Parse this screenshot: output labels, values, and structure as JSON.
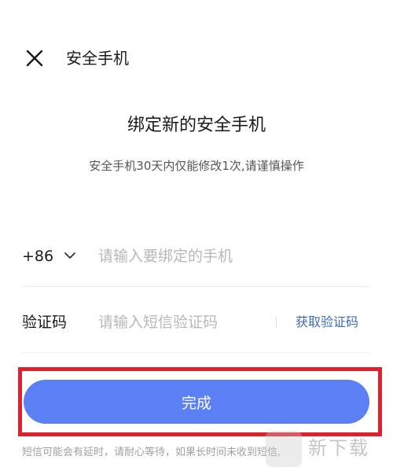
{
  "header": {
    "title": "安全手机"
  },
  "main": {
    "title": "绑定新的安全手机",
    "subtitle": "安全手机30天内仅能修改1次,请谨慎操作"
  },
  "phone_row": {
    "country_code": "+86",
    "placeholder": "请输入要绑定的手机",
    "value": ""
  },
  "code_row": {
    "label": "验证码",
    "placeholder": "请输入短信验证码",
    "value": "",
    "get_code_label": "获取验证码"
  },
  "done_button": {
    "label": "完成"
  },
  "note": {
    "line1": "短信可能会有延时，请耐心等待，如果长时间未收到短信,"
  },
  "watermark": {
    "text": "新下载"
  },
  "colors": {
    "accent": "#5b80f3",
    "link": "#3d6db5",
    "highlight": "#e0202e"
  },
  "icons": {
    "close": "close-icon",
    "dropdown": "chevron-down-icon"
  }
}
